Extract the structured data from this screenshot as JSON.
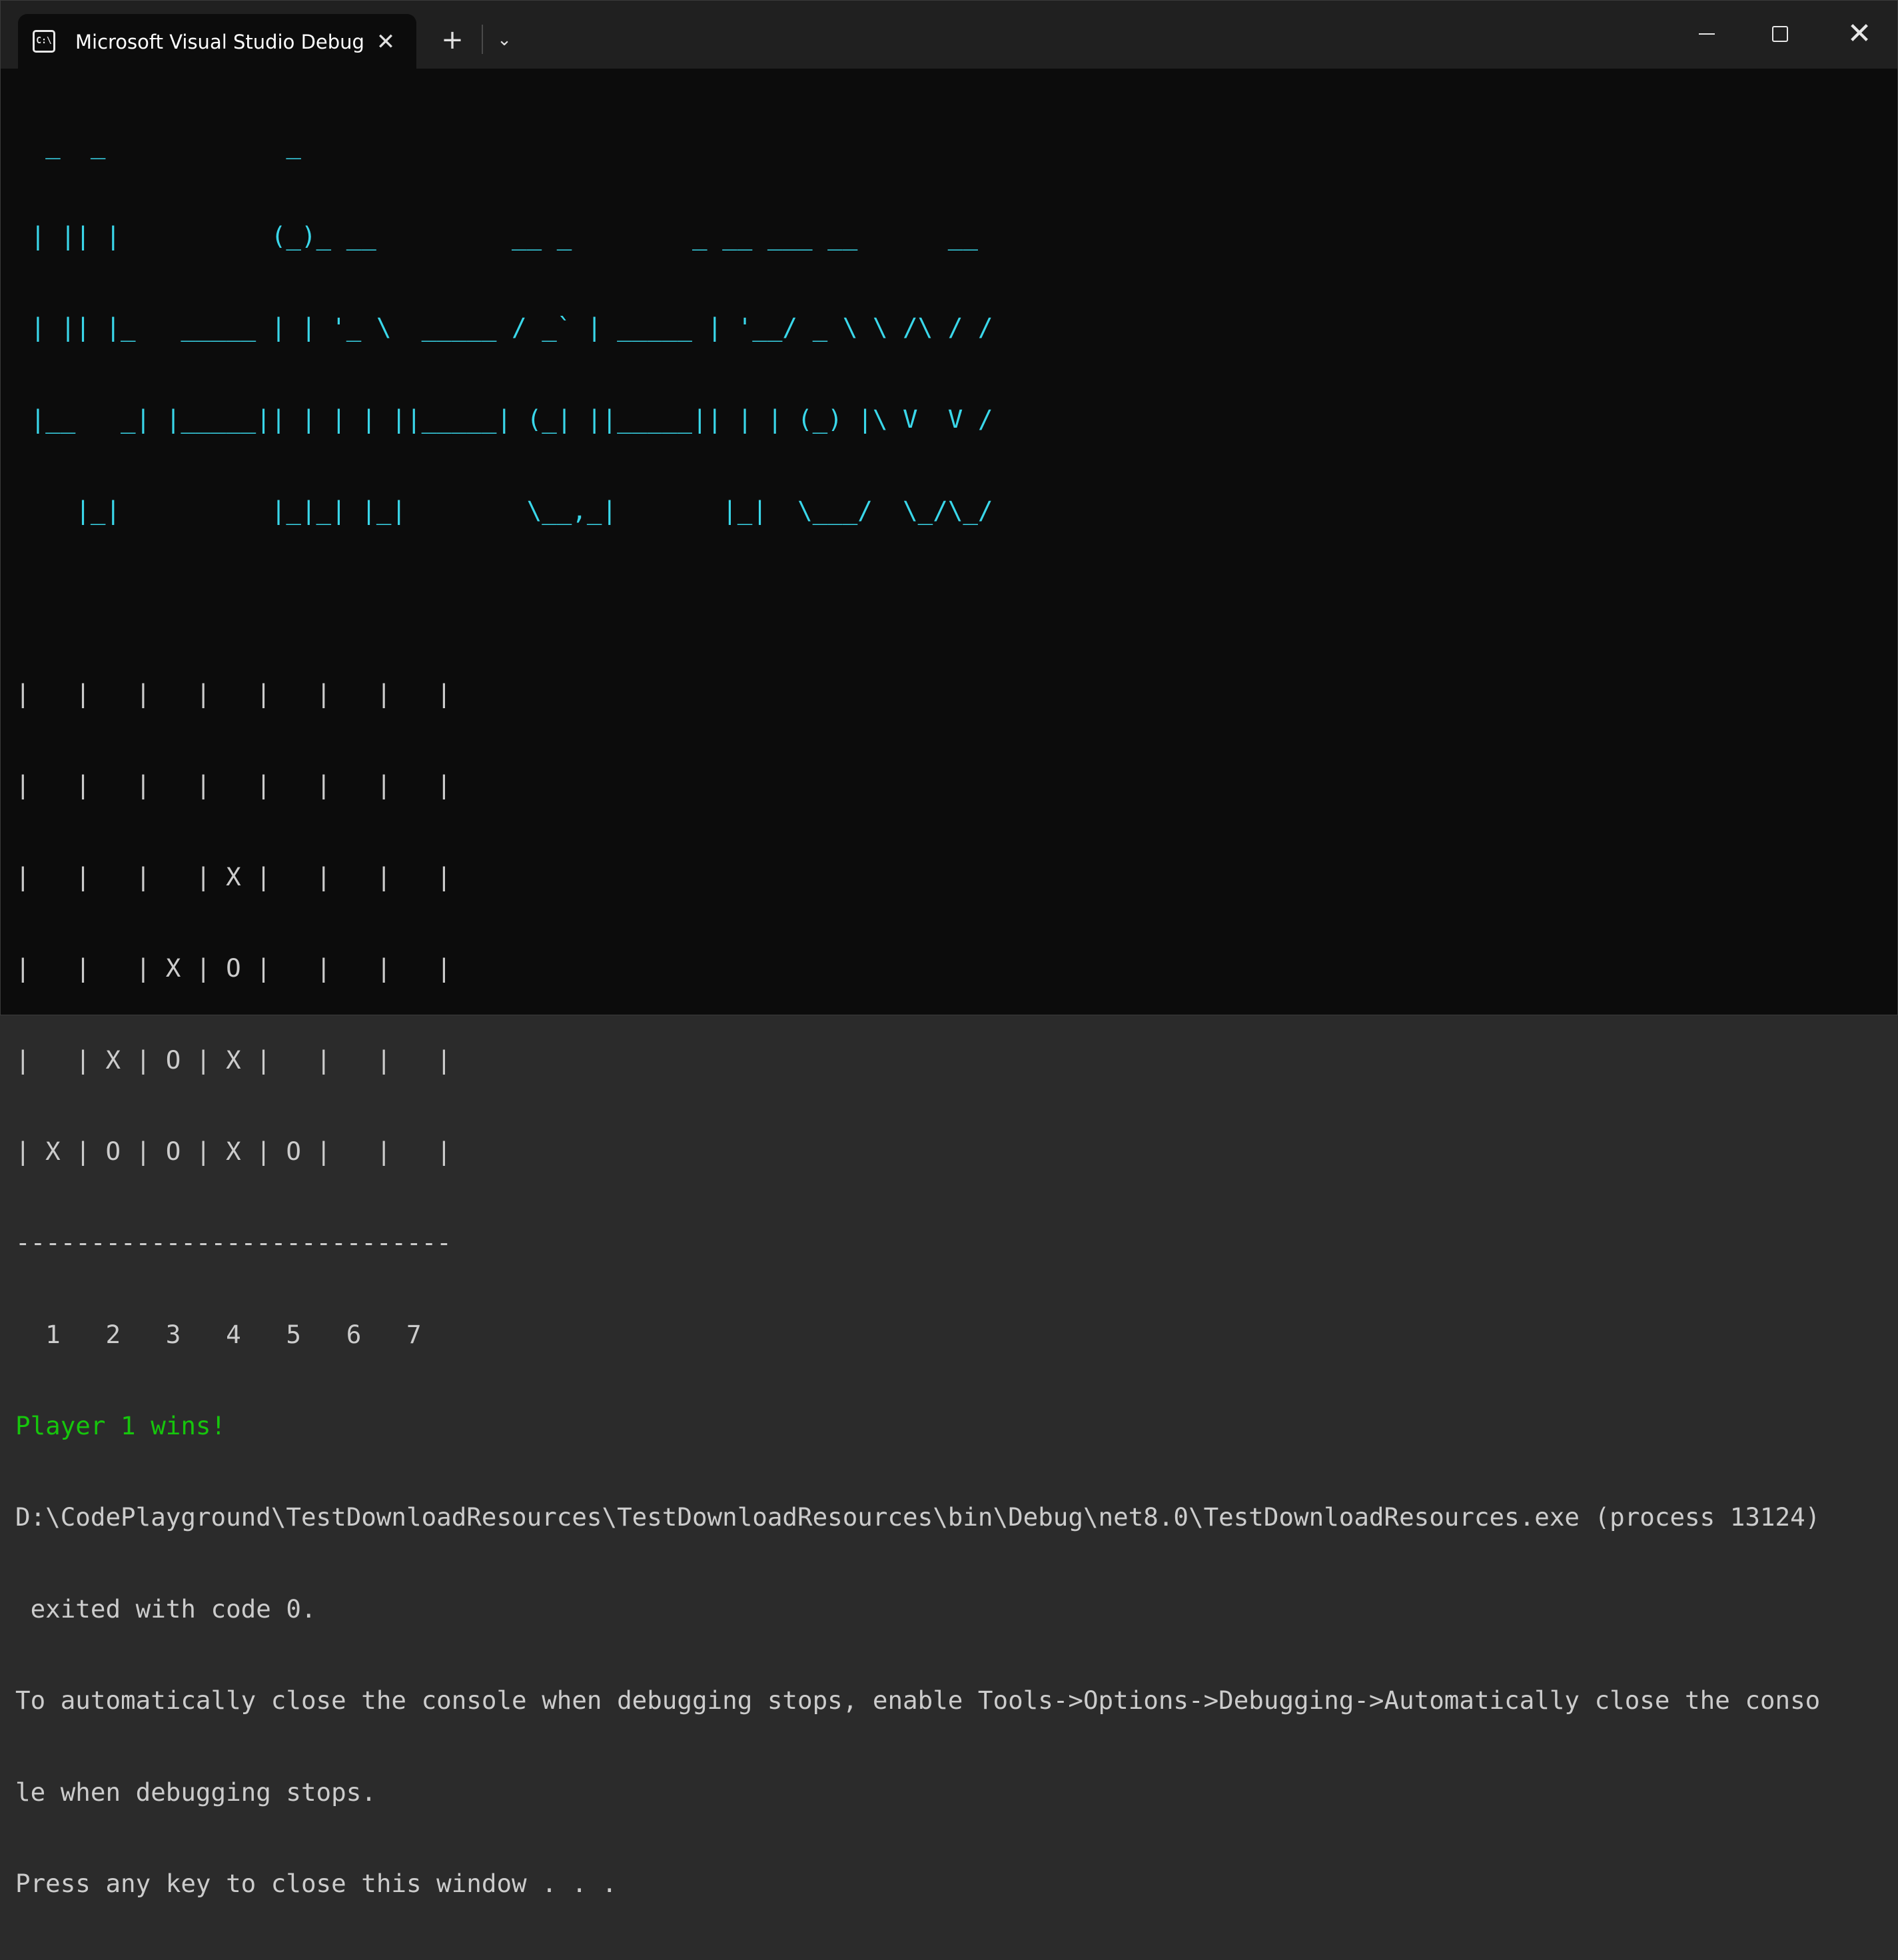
{
  "window": {
    "tab_icon_text": "C:\\",
    "tab_title": "Microsoft Visual Studio Debug Console",
    "tab_close": "✕",
    "new_tab": "+",
    "dropdown": "⌄",
    "close_button": "✕",
    "icons": {
      "tab": "console-icon",
      "close_tab": "close-icon",
      "new_tab": "plus-icon",
      "dropdown": "chevron-down-icon",
      "minimize": "minimize-icon",
      "maximize": "maximize-icon",
      "close": "close-icon"
    }
  },
  "colors": {
    "background": "#0c0c0c",
    "text": "#cccccc",
    "banner": "#3ad7ea",
    "win_message": "#16c60c",
    "titlebar": "#202020"
  },
  "banner": [
    "  _  _            _                               ",
    " | || |          (_)_ __         __ _        _ __ ___ __      __",
    " | || |_   _____ | | '_ \\  _____ / _` | _____ | '__/ _ \\ \\ /\\ / /",
    " |__   _| |_____|| | | | ||_____| (_| ||_____|| | | (_) |\\ V  V /",
    "    |_|          |_|_| |_|        \\__,_|       |_|  \\___/  \\_/\\_/"
  ],
  "board": {
    "rows": [
      "|   |   |   |   |   |   |   |",
      "|   |   |   |   |   |   |   |",
      "|   |   |   | X |   |   |   |",
      "|   |   | X | O |   |   |   |",
      "|   | X | O | X |   |   |   |",
      "| X | O | O | X | O |   |   |"
    ],
    "divider": "-----------------------------",
    "column_numbers": "  1   2   3   4   5   6   7"
  },
  "result": "Player 1 wins!",
  "exit_lines": [
    "D:\\CodePlayground\\TestDownloadResources\\TestDownloadResources\\bin\\Debug\\net8.0\\TestDownloadResources.exe (process 13124)",
    " exited with code 0.",
    "To automatically close the console when debugging stops, enable Tools->Options->Debugging->Automatically close the conso",
    "le when debugging stops.",
    "Press any key to close this window . . ."
  ]
}
